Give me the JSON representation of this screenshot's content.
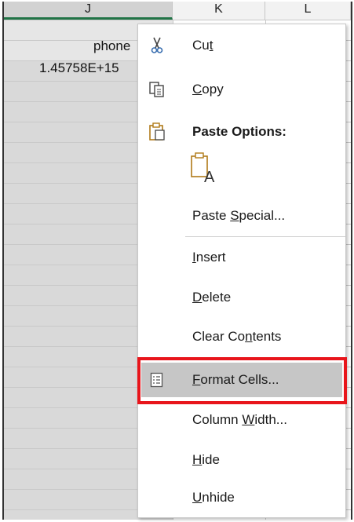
{
  "columns": [
    {
      "letter": "J",
      "selected": true
    },
    {
      "letter": "K",
      "selected": false
    },
    {
      "letter": "L",
      "selected": false
    }
  ],
  "cells": {
    "j1": "phone",
    "j2": "1.45758E+15"
  },
  "menu": {
    "cut": {
      "pre": "Cu",
      "ul": "t",
      "post": "",
      "icon": "scissors-icon"
    },
    "copy": {
      "pre": "",
      "ul": "C",
      "post": "opy",
      "icon": "copy-icon"
    },
    "paste_options": {
      "label": "Paste Options:",
      "icon": "clipboard-icon"
    },
    "paste_a": {
      "icon": "paste-values-icon",
      "glyph": "A"
    },
    "paste_special": {
      "pre": "Paste ",
      "ul": "S",
      "post": "pecial..."
    },
    "insert": {
      "pre": "",
      "ul": "I",
      "post": "nsert"
    },
    "delete": {
      "pre": "",
      "ul": "D",
      "post": "elete"
    },
    "clear_contents": {
      "pre": "Clear Co",
      "ul": "n",
      "post": "tents"
    },
    "format_cells": {
      "pre": "",
      "ul": "F",
      "post": "ormat Cells...",
      "icon": "format-cells-icon"
    },
    "column_width": {
      "pre": "Column ",
      "ul": "W",
      "post": "idth..."
    },
    "hide": {
      "pre": "",
      "ul": "H",
      "post": "ide"
    },
    "unhide": {
      "pre": "",
      "ul": "U",
      "post": "nhide"
    }
  },
  "colors": {
    "highlight_border": "#e8151b",
    "selected_column": "#d9d9d9",
    "excel_green": "#217346"
  }
}
